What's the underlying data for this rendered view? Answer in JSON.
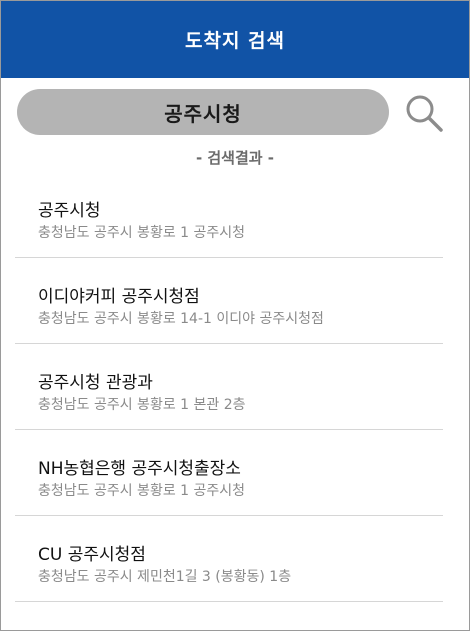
{
  "header": {
    "title": "도착지 검색"
  },
  "search": {
    "value": "공주시청",
    "button_icon": "search-icon"
  },
  "results_caption": "- 검색결과 -",
  "colors": {
    "header_bg": "#1153a6",
    "search_bg": "#b4b4b4",
    "divider": "#d6d6d6"
  },
  "results": [
    {
      "name": "공주시청",
      "address": "충청남도 공주시 봉황로 1 공주시청"
    },
    {
      "name": "이디야커피 공주시청점",
      "address": "충청남도 공주시 봉황로 14-1 이디야 공주시청점"
    },
    {
      "name": "공주시청 관광과",
      "address": "충청남도 공주시 봉황로 1 본관 2층"
    },
    {
      "name": "NH농협은행 공주시청출장소",
      "address": "충청남도 공주시 봉황로 1 공주시청"
    },
    {
      "name": "CU 공주시청점",
      "address": "충청남도 공주시 제민천1길 3 (봉황동) 1층"
    }
  ]
}
